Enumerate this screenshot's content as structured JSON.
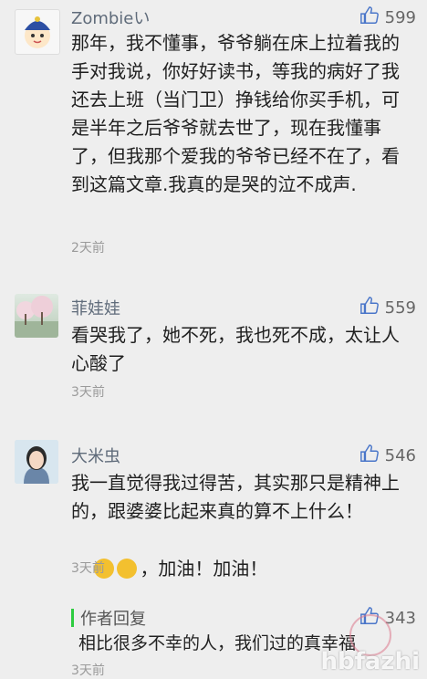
{
  "comments": [
    {
      "name": "Zombieい",
      "likes": "599",
      "text": "那年，我不懂事，爷爷躺在床上拉着我的手对我说，你好好读书，等我的病好了我还去上班（当门卫）挣钱给你买手机，可是半年之后爷爷就去世了，现在我懂事了，但我那个爱我的爷爷已经不在了，看到这篇文章.我真的是哭的泣不成声.",
      "time": "2天前"
    },
    {
      "name": "菲娃娃",
      "likes": "559",
      "text": "看哭我了，她不死，我也死不成，太让人心酸了",
      "time": "3天前"
    },
    {
      "name": "大米虫",
      "likes": "546",
      "text": "我一直觉得我过得苦，其实那只是精神上的，跟婆婆比起来真的算不上什么！",
      "text2": "，加油！加油！",
      "time": "3天前"
    }
  ],
  "reply": {
    "title": "作者回复",
    "likes": "343",
    "text": "相比很多不幸的人，我们过的真幸福",
    "time": "3天前"
  },
  "watermark": "hbfazhi",
  "icons": {
    "like": "thumbs-up-icon",
    "emoji": "crying-face-icon"
  },
  "colors": {
    "background": "#eeeeee",
    "name": "#5f6b7a",
    "reply_bar": "#2ecc40"
  }
}
